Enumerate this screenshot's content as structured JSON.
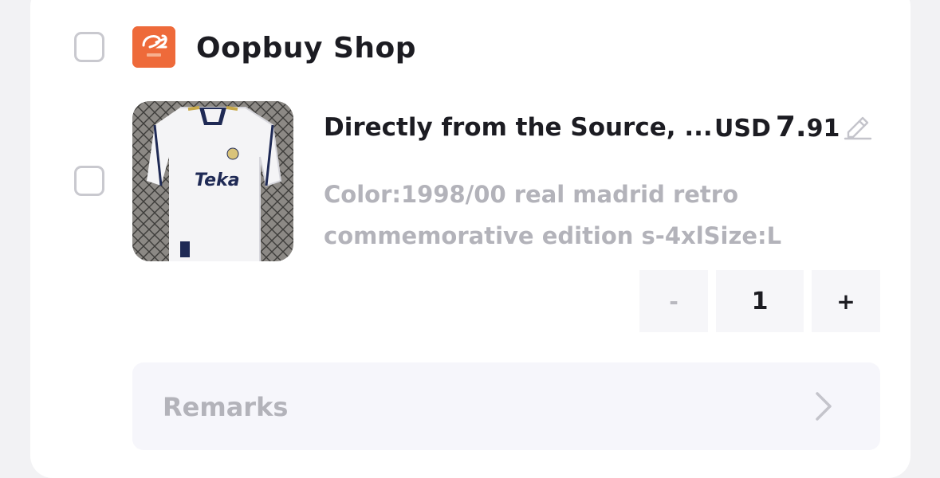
{
  "shop": {
    "name": "Oopbuy Shop",
    "logo_icon": "1688-shop-logo-icon",
    "logo_color": "#ee6a3a"
  },
  "item": {
    "title": "Directly from the Source, ...",
    "price_currency": "USD",
    "price_integer": "7.",
    "price_decimal": "91",
    "spec": "Color:1998/00 real madrid retro commemorative edition s-4xlSize:L",
    "image": "white-football-jersey-photo"
  },
  "quantity": {
    "minus_label": "-",
    "value": "1",
    "plus_label": "+"
  },
  "remarks": {
    "label": "Remarks"
  },
  "icons": {
    "edit": "pencil-icon",
    "chevron": "chevron-right-icon"
  }
}
